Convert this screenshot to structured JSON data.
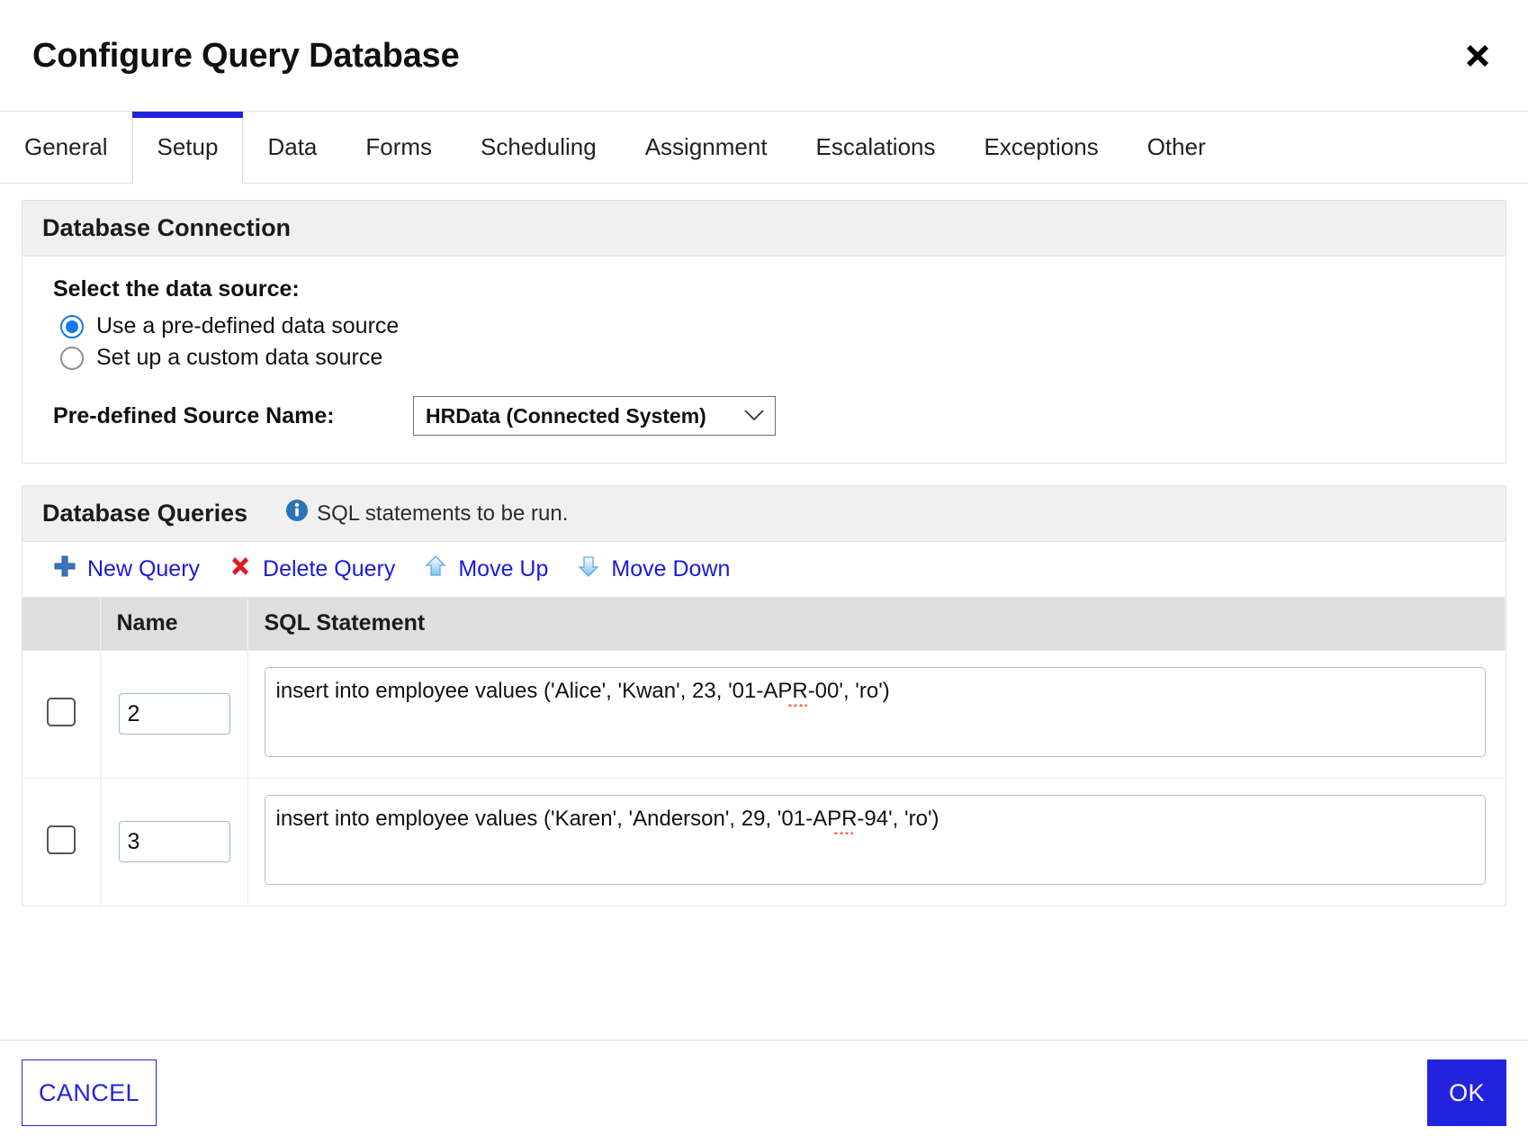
{
  "dialog": {
    "title": "Configure Query Database",
    "close_icon": "close-icon"
  },
  "tabs": [
    {
      "label": "General",
      "active": false
    },
    {
      "label": "Setup",
      "active": true
    },
    {
      "label": "Data",
      "active": false
    },
    {
      "label": "Forms",
      "active": false
    },
    {
      "label": "Scheduling",
      "active": false
    },
    {
      "label": "Assignment",
      "active": false
    },
    {
      "label": "Escalations",
      "active": false
    },
    {
      "label": "Exceptions",
      "active": false
    },
    {
      "label": "Other",
      "active": false
    }
  ],
  "connection": {
    "panel_title": "Database Connection",
    "select_label": "Select the data source:",
    "options": [
      {
        "label": "Use a pre-defined data source",
        "selected": true
      },
      {
        "label": "Set up a custom data source",
        "selected": false
      }
    ],
    "source_name_label": "Pre-defined Source Name:",
    "source_name_value": "HRData (Connected System)",
    "caret_glyph": "⌄"
  },
  "queries": {
    "panel_title": "Database Queries",
    "hint_text": "SQL statements to be run.",
    "hint_icon": "info-icon",
    "toolbar": [
      {
        "label": "New Query",
        "icon": "plus-icon",
        "color": "#2f6fb8"
      },
      {
        "label": "Delete Query",
        "icon": "delete-x-icon",
        "color": "#e01b24"
      },
      {
        "label": "Move Up",
        "icon": "arrow-up-icon",
        "color": "#9fd0f5"
      },
      {
        "label": "Move Down",
        "icon": "arrow-down-icon",
        "color": "#9fd0f5"
      }
    ],
    "columns": [
      "",
      "Name",
      "SQL Statement"
    ],
    "rows": [
      {
        "checked": false,
        "name": "2",
        "sql": "insert into employee values ('Alice', 'Kwan', 23, '01-APR-00', 'ro')"
      },
      {
        "checked": false,
        "name": "3",
        "sql": "insert into employee values ('Karen', 'Anderson', 29, '01-APR-94', 'ro')"
      }
    ]
  },
  "footer": {
    "cancel_label": "CANCEL",
    "ok_label": "OK"
  },
  "colors": {
    "accent": "#2323dd",
    "link": "#1b1bd6",
    "panel_header_bg": "#f0f0f0",
    "table_header_bg": "#dedede",
    "radio_blue": "#1479e8",
    "delete_red": "#e01b24"
  }
}
